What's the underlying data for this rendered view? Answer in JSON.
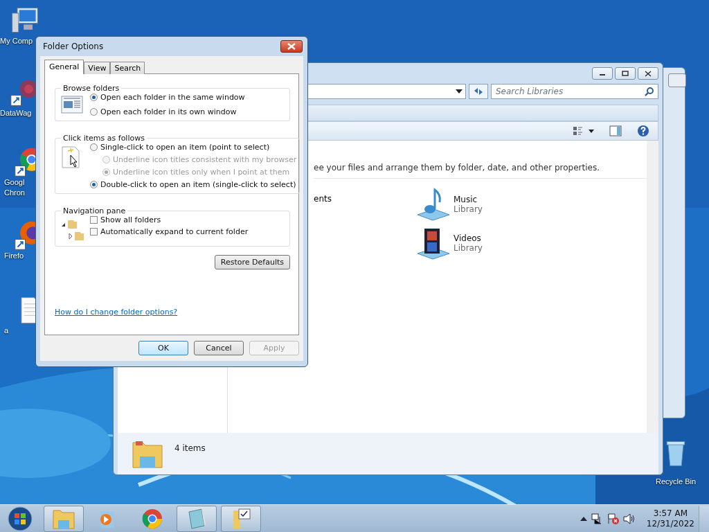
{
  "desktop_icons": [
    {
      "kind": "computer",
      "lines": [
        "My Comp"
      ]
    },
    {
      "kind": "burst",
      "lines": [
        "DataWag"
      ]
    },
    {
      "kind": "chrome",
      "lines": [
        "Googl",
        "Chron"
      ]
    },
    {
      "kind": "firefox",
      "lines": [
        "Firefo"
      ]
    },
    {
      "kind": "document",
      "lines": [
        "a"
      ]
    },
    {
      "kind": "recycle",
      "lines": [
        "Recycle Bin"
      ]
    }
  ],
  "explorer": {
    "search": {
      "placeholder": "Search Libraries"
    },
    "description": "ee your files and arrange them by folder, date, and other properties.",
    "libraries": [
      {
        "kind": "cut",
        "name": "ents"
      },
      {
        "kind": "music",
        "name": "Music",
        "type": "Library"
      },
      {
        "kind": "videos",
        "name": "Videos",
        "type": "Library"
      }
    ],
    "status": "4 items"
  },
  "dialog": {
    "title": "Folder Options",
    "tabs": [
      {
        "label": "General",
        "selected": true
      },
      {
        "label": "View",
        "selected": false
      },
      {
        "label": "Search",
        "selected": false
      }
    ],
    "groups": [
      {
        "kind": "browse",
        "title": "Browse folders",
        "options": [
          {
            "kind": "radio",
            "label": "Open each folder in the same window",
            "selected": true,
            "disabled": false
          },
          {
            "kind": "radio",
            "label": "Open each folder in its own window",
            "selected": false,
            "disabled": false
          }
        ]
      },
      {
        "kind": "click",
        "title": "Click items as follows",
        "options": [
          {
            "kind": "radio",
            "label": "Single-click to open an item (point to select)",
            "selected": false,
            "disabled": false,
            "children": [
              {
                "kind": "radio",
                "label": "Underline icon titles consistent with my browser",
                "selected": false,
                "disabled": true
              },
              {
                "kind": "radio",
                "label": "Underline icon titles only when I point at them",
                "selected": true,
                "disabled": true
              }
            ]
          },
          {
            "kind": "radio",
            "label": "Double-click to open an item (single-click to select)",
            "selected": true,
            "disabled": false
          }
        ]
      },
      {
        "kind": "nav",
        "title": "Navigation pane",
        "options": [
          {
            "kind": "checkbox",
            "label": "Show all folders",
            "checked": false,
            "disabled": false
          },
          {
            "kind": "checkbox",
            "label": "Automatically expand to current folder",
            "checked": false,
            "disabled": false
          }
        ]
      }
    ],
    "restore": "Restore Defaults",
    "help_link": "How do I change folder options?",
    "buttons": [
      {
        "label": "OK",
        "disabled": false,
        "default": true
      },
      {
        "label": "Cancel",
        "disabled": false,
        "default": false
      },
      {
        "label": "Apply",
        "disabled": true,
        "default": false
      }
    ]
  },
  "taskbar": {
    "apps": [
      {
        "kind": "explorer",
        "open": true
      },
      {
        "kind": "media",
        "open": false
      },
      {
        "kind": "chrome",
        "open": false
      },
      {
        "kind": "notepad",
        "open": true
      },
      {
        "kind": "folderopts",
        "open": true
      }
    ],
    "time": "3:57 AM",
    "date": "12/31/2022"
  }
}
